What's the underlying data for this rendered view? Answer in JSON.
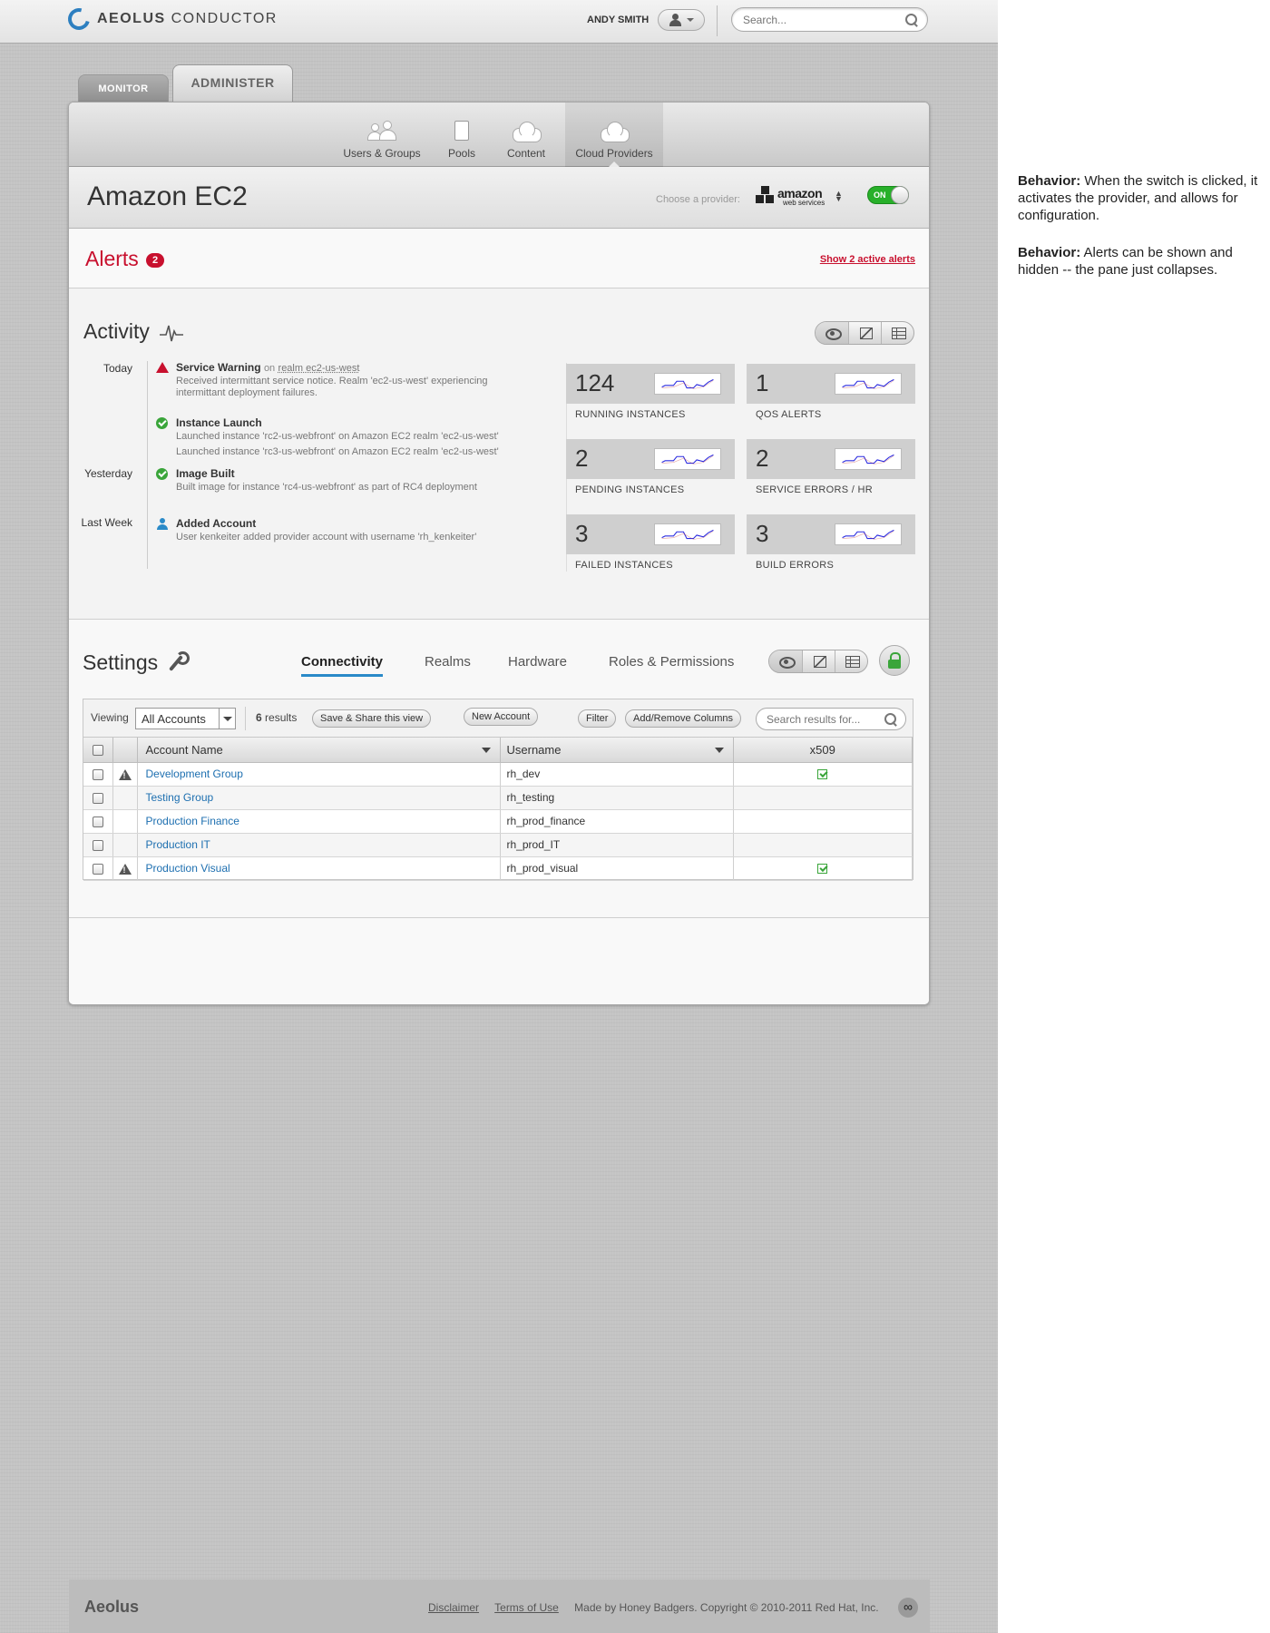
{
  "header": {
    "brand_bold": "AEOLUS",
    "brand_rest": "CONDUCTOR",
    "user_name": "ANDY SMITH",
    "search_placeholder": "Search..."
  },
  "tabs": {
    "monitor": "MONITOR",
    "administer": "ADMINISTER"
  },
  "subnav": [
    {
      "label": "Users & Groups",
      "icon": "users-icon"
    },
    {
      "label": "Pools",
      "icon": "pools-icon"
    },
    {
      "label": "Content",
      "icon": "content-cloud-icon"
    },
    {
      "label": "Cloud Providers",
      "icon": "cloud-providers-icon",
      "active": true
    }
  ],
  "provider": {
    "title": "Amazon EC2",
    "choose_label": "Choose a provider:",
    "selected_logo": "amazon",
    "selected_logo_sub": "web services",
    "switch_label": "ON"
  },
  "alerts": {
    "title": "Alerts",
    "count": "2",
    "link": "Show 2 active alerts"
  },
  "activity": {
    "title": "Activity",
    "timeline": {
      "today": "Today",
      "yesterday": "Yesterday",
      "last_week": "Last Week",
      "events": [
        {
          "title": "Service Warning",
          "on": "on",
          "link": "realm ec2-us-west",
          "desc": "Received intermittant service notice. Realm 'ec2-us-west' experiencing intermittant deployment failures."
        },
        {
          "title": "Instance Launch",
          "desc1": "Launched instance 'rc2-us-webfront' on Amazon EC2 realm 'ec2-us-west'",
          "desc2": "Launched instance 'rc3-us-webfront' on Amazon EC2 realm 'ec2-us-west'"
        },
        {
          "title": "Image Built",
          "desc": "Built image for instance 'rc4-us-webfront' as part of RC4 deployment"
        },
        {
          "title": "Added Account",
          "desc": "User kenkeiter added provider account with username 'rh_kenkeiter'"
        }
      ]
    },
    "stats": [
      {
        "value": "124",
        "label": "RUNNING INSTANCES"
      },
      {
        "value": "1",
        "label": "QOS ALERTS"
      },
      {
        "value": "2",
        "label": "PENDING INSTANCES"
      },
      {
        "value": "2",
        "label": "SERVICE ERRORS / HR"
      },
      {
        "value": "3",
        "label": "FAILED INSTANCES"
      },
      {
        "value": "3",
        "label": "BUILD ERRORS"
      }
    ]
  },
  "settings": {
    "title": "Settings",
    "tabs": [
      "Connectivity",
      "Realms",
      "Hardware",
      "Roles & Permissions"
    ],
    "toolbar": {
      "viewing_label": "Viewing",
      "viewing_value": "All Accounts",
      "results_count": "6",
      "results_label": "results",
      "save_share": "Save & Share this view",
      "new_account": "New Account",
      "filter": "Filter",
      "add_remove_columns": "Add/Remove Columns",
      "search_placeholder": "Search results for..."
    },
    "columns": [
      "Account Name",
      "Username",
      "x509"
    ],
    "rows": [
      {
        "account": "Development Group",
        "username": "rh_dev",
        "warning": true,
        "x509": true
      },
      {
        "account": "Testing Group",
        "username": "rh_testing",
        "warning": false,
        "x509": false
      },
      {
        "account": "Production Finance",
        "username": "rh_prod_finance",
        "warning": false,
        "x509": false
      },
      {
        "account": "Production IT",
        "username": "rh_prod_IT",
        "warning": false,
        "x509": false
      },
      {
        "account": "Production Visual",
        "username": "rh_prod_visual",
        "warning": true,
        "x509": true
      }
    ]
  },
  "footer": {
    "brand": "Aeolus",
    "disclaimer": "Disclaimer",
    "terms": "Terms of Use",
    "credit": "Made by Honey Badgers. Copyright © 2010-2011 Red Hat, Inc.",
    "badge": "∞"
  },
  "notes": [
    {
      "label": "Behavior:",
      "text": "When the switch is clicked, it activates the provider, and allows for configuration."
    },
    {
      "label": "Behavior:",
      "text": "Alerts can be shown and hidden -- the pane just collapses."
    }
  ]
}
